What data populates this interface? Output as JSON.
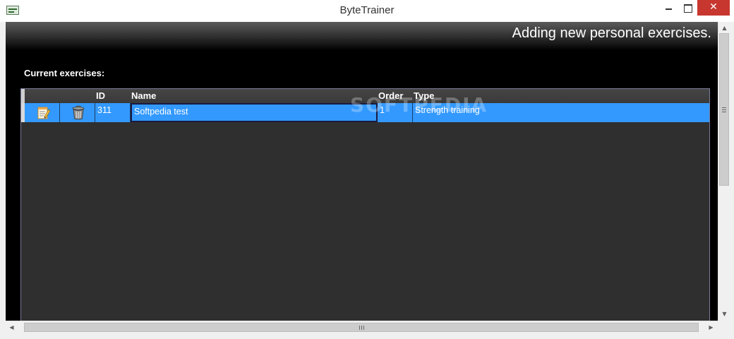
{
  "window": {
    "title": "ByteTrainer",
    "close_glyph": "✕"
  },
  "header": {
    "title": "Adding new personal exercises."
  },
  "exercises": {
    "section_label": "Current exercises:",
    "columns": {
      "id": "ID",
      "name": "Name",
      "order": "Order",
      "type": "Type"
    },
    "rows": [
      {
        "id": "311",
        "name": "Softpedia test",
        "order": "1",
        "type": "Strength training"
      }
    ],
    "row_actions": {
      "edit_icon": "edit-icon",
      "delete_icon": "trash-icon"
    },
    "selected_row_color": "#3399ff"
  },
  "watermark": {
    "text": "SOFTPEDIA"
  },
  "scrollbars": {
    "up_glyph": "▲",
    "down_glyph": "▼",
    "left_glyph": "◀",
    "right_glyph": "▶"
  },
  "colors": {
    "close_button": "#c7372f",
    "client_background": "#000000",
    "grid_background": "#2f2f2f"
  }
}
